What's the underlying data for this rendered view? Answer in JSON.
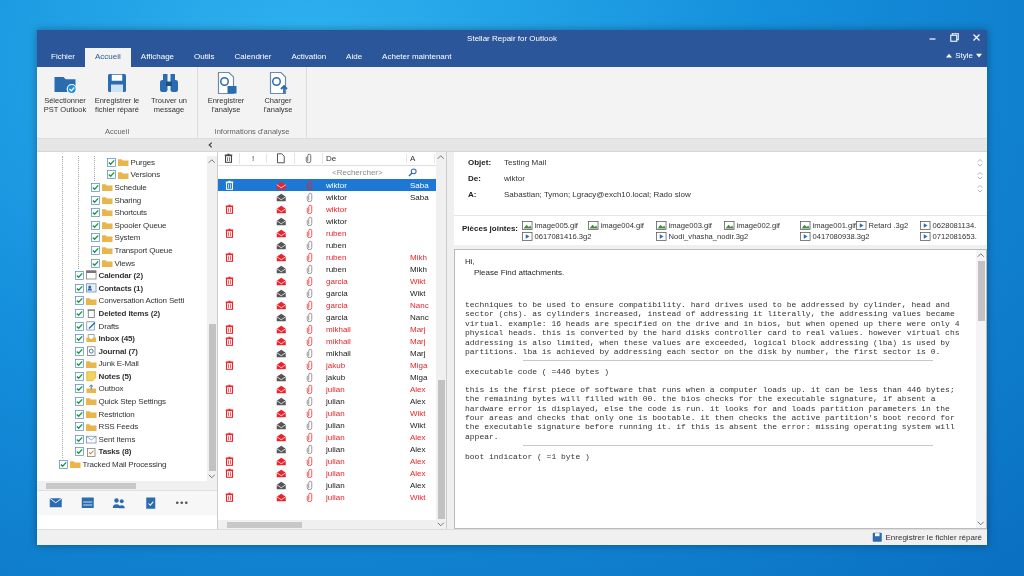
{
  "window": {
    "title": "Stellar Repair for Outlook"
  },
  "tabs": [
    {
      "label": "Fichier",
      "selected": false
    },
    {
      "label": "Accueil",
      "selected": true
    },
    {
      "label": "Affichage",
      "selected": false
    },
    {
      "label": "Outils",
      "selected": false
    },
    {
      "label": "Calendrier",
      "selected": false
    },
    {
      "label": "Activation",
      "selected": false
    },
    {
      "label": "Aide",
      "selected": false
    },
    {
      "label": "Acheter maintenant",
      "selected": false
    }
  ],
  "style_menu": {
    "label": "Style"
  },
  "ribbon_groups": [
    {
      "label": "Accueil",
      "buttons": [
        {
          "kind": "folder",
          "label": "Sélectionner PST Outlook"
        },
        {
          "kind": "save",
          "label": "Enregistrer le fichier réparé"
        },
        {
          "kind": "binoculars",
          "label": "Trouver un message"
        }
      ]
    },
    {
      "label": "Informations d'analyse",
      "buttons": [
        {
          "kind": "save-scan",
          "label": "Enregistrer l'analyse"
        },
        {
          "kind": "load-scan",
          "label": "Charger l'analyse"
        }
      ]
    }
  ],
  "folders": [
    {
      "children": [
        {
          "children": [
            {
              "children": [
                {
                  "label": "Purges",
                  "kind": "folder",
                  "checked": true,
                  "bold": false
                },
                {
                  "label": "Versions",
                  "kind": "folder",
                  "checked": true,
                  "bold": false
                }
              ]
            },
            {
              "label": "Schedule",
              "kind": "folder",
              "checked": true,
              "bold": false
            },
            {
              "label": "Sharing",
              "kind": "folder",
              "checked": true,
              "bold": false
            },
            {
              "label": "Shortcuts",
              "kind": "folder",
              "checked": true,
              "bold": false
            },
            {
              "label": "Spooler Queue",
              "kind": "folder",
              "checked": true,
              "bold": false
            },
            {
              "label": "System",
              "kind": "folder",
              "checked": true,
              "bold": false
            },
            {
              "label": "Transport Queue",
              "kind": "folder",
              "checked": true,
              "bold": false
            },
            {
              "label": "Views",
              "kind": "folder",
              "checked": true,
              "bold": false
            }
          ]
        },
        {
          "label": "Calendar (2)",
          "kind": "calendar",
          "checked": true,
          "bold": true
        },
        {
          "label": "Contacts (1)",
          "kind": "contacts",
          "checked": true,
          "bold": true
        },
        {
          "label": "Conversation Action Setti",
          "kind": "folder",
          "checked": true,
          "bold": false
        },
        {
          "label": "Deleted Items (2)",
          "kind": "trash",
          "checked": true,
          "bold": true
        },
        {
          "label": "Drafts",
          "kind": "drafts",
          "checked": true,
          "bold": false
        },
        {
          "label": "Inbox (45)",
          "kind": "inbox",
          "checked": true,
          "bold": true
        },
        {
          "label": "Journal (7)",
          "kind": "journal",
          "checked": true,
          "bold": true
        },
        {
          "label": "Junk E-Mail",
          "kind": "folder",
          "checked": true,
          "bold": false
        },
        {
          "label": "Notes (5)",
          "kind": "notes",
          "checked": true,
          "bold": true
        },
        {
          "label": "Outbox",
          "kind": "outbox",
          "checked": true,
          "bold": false
        },
        {
          "label": "Quick Step Settings",
          "kind": "folder",
          "checked": true,
          "bold": false
        },
        {
          "label": "Restriction",
          "kind": "folder",
          "checked": true,
          "bold": false
        },
        {
          "label": "RSS Feeds",
          "kind": "folder",
          "checked": true,
          "bold": false
        },
        {
          "label": "Sent Items",
          "kind": "sent",
          "checked": true,
          "bold": false
        },
        {
          "label": "Tasks (8)",
          "kind": "tasks",
          "checked": true,
          "bold": true
        }
      ]
    },
    {
      "label": "Tracked Mail Processing",
      "kind": "folder",
      "checked": true,
      "bold": false
    }
  ],
  "nav": [
    {
      "kind": "mail"
    },
    {
      "kind": "calendar"
    },
    {
      "kind": "contacts"
    },
    {
      "kind": "tasks"
    },
    {
      "kind": "more"
    }
  ],
  "message_list": {
    "columns": [
      {
        "kind": "trash"
      },
      {
        "kind": "text",
        "label": "!"
      },
      {
        "kind": "document"
      },
      {
        "kind": "clip"
      },
      {
        "kind": "text",
        "label": "De"
      },
      {
        "kind": "text",
        "label": "A"
      }
    ],
    "search": {
      "placeholder": "<Rechercher>"
    },
    "rows": [
      {
        "from": "wiktor",
        "to": "Saba",
        "deleted": true,
        "selected": true
      },
      {
        "from": "wiktor",
        "to": "Saba",
        "deleted": false,
        "selected": false
      },
      {
        "from": "wiktor",
        "deleted": true,
        "selected": false
      },
      {
        "from": "wiktor",
        "deleted": false,
        "selected": false
      },
      {
        "from": "ruben",
        "deleted": true,
        "selected": false
      },
      {
        "from": "ruben",
        "deleted": false,
        "selected": false
      },
      {
        "from": "ruben",
        "to": "Mikh",
        "deleted": true,
        "selected": false
      },
      {
        "from": "ruben",
        "to": "Mikh",
        "deleted": false,
        "selected": false
      },
      {
        "from": "garcia",
        "to": "Wikt",
        "deleted": true,
        "selected": false
      },
      {
        "from": "garcia",
        "to": "Wikt",
        "deleted": false,
        "selected": false
      },
      {
        "from": "garcia",
        "to": "Nanc",
        "deleted": true,
        "selected": false
      },
      {
        "from": "garcia",
        "to": "Nanc",
        "deleted": false,
        "selected": false
      },
      {
        "from": "mikhail",
        "to": "Marj",
        "deleted": true,
        "selected": false
      },
      {
        "from": "mikhail",
        "to": "Marj",
        "deleted": true,
        "selected": false
      },
      {
        "from": "mikhail",
        "to": "Marj",
        "deleted": false,
        "selected": false
      },
      {
        "from": "jakub",
        "to": "Miga",
        "deleted": true,
        "selected": false
      },
      {
        "from": "jakub",
        "to": "Miga",
        "deleted": false,
        "selected": false
      },
      {
        "from": "julian",
        "to": "Alex",
        "deleted": true,
        "selected": false
      },
      {
        "from": "julian",
        "to": "Alex",
        "deleted": false,
        "selected": false
      },
      {
        "from": "julian",
        "to": "Wikt",
        "deleted": true,
        "selected": false
      },
      {
        "from": "julian",
        "to": "Wikt",
        "deleted": false,
        "selected": false
      },
      {
        "from": "julian",
        "to": "Alex",
        "deleted": true,
        "selected": false
      },
      {
        "from": "julian",
        "to": "Alex",
        "deleted": false,
        "selected": false
      },
      {
        "from": "julian",
        "to": "Alex",
        "deleted": true,
        "selected": false
      },
      {
        "from": "julian",
        "to": "Alex",
        "deleted": true,
        "selected": false
      },
      {
        "from": "julian",
        "to": "Alex",
        "deleted": false,
        "selected": false
      },
      {
        "from": "julian",
        "to": "Wikt",
        "deleted": true,
        "selected": false
      }
    ]
  },
  "message": {
    "fields": [
      {
        "label": "Objet:",
        "value": "Testing Mail"
      },
      {
        "label": "De:",
        "value": "wiktor"
      },
      {
        "label": "A:",
        "value": "Sabastian; Tymon; Lgracy@exch10.local; Rado slow"
      }
    ],
    "attachments_label": "Pièces jointes:",
    "attachment_rows": [
      [
        {
          "kind": "image",
          "name": "image005.gif"
        },
        {
          "kind": "image",
          "name": "image004.gif"
        },
        {
          "kind": "image",
          "name": "image003.gif"
        },
        {
          "kind": "image",
          "name": "image002.gif"
        },
        {
          "kind": "image",
          "name": "image001.gif"
        },
        {
          "kind": "media",
          "name": "Retard .3g2"
        },
        {
          "kind": "media",
          "name": "0628081134."
        }
      ],
      [
        {
          "kind": "media",
          "name": "0617081416.3g2"
        },
        {
          "kind": "media",
          "name": "Nodi_vhasha_nodir.3g2"
        },
        {
          "kind": "media",
          "name": "0417080938.3g2"
        },
        {
          "kind": "media",
          "name": "0712081653."
        }
      ]
    ],
    "body": [
      {
        "kind": "greeting",
        "text": "Hi,"
      },
      {
        "kind": "indent",
        "text": "Please Find attachments."
      },
      {
        "kind": "gap"
      },
      {
        "kind": "mono",
        "text": "techniques to be used to ensure compatibility. hard drives used to be addressed by cylinder, head and sector (chs). as cylinders increased, instead of addressing it literally, the addressing values became virtual. example: 16 heads are specified on the drive and in bios, but when opened up there were only 4 physical heads. this is converted by the hard disks controller card to real values. however virtual chs addressing is also limited, when these values are exceeded, logical block addressing (lba) is used by partitions. lba is achieved by addressing each sector on the disk by number, the first sector is 0."
      },
      {
        "kind": "rule"
      },
      {
        "kind": "mono",
        "text": "executable code ( =446 bytes )"
      },
      {
        "kind": "mono",
        "text": "this is the first piece of software that runs when a computer loads up. it can be less than 446 bytes; the remaining bytes will filled with 00. the bios checks for the executable signature, if absent a hardware error is displayed, else the code is run. it looks for and loads partition parameters in the four areas and checks that only one is bootable. it then checks the active partition's boot record for the executable signature before running it. if this is absent the error: missing operating system will appear."
      },
      {
        "kind": "rule"
      },
      {
        "kind": "mono",
        "text": "boot indicator ( =1 byte )"
      }
    ]
  },
  "status_bar": {
    "save_label": "Enregistrer le fichier réparé"
  }
}
